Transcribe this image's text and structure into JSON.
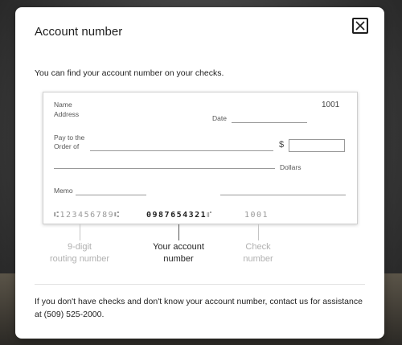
{
  "dialog": {
    "title": "Account number",
    "close_label": "close",
    "description": "You can find your account number on your checks.",
    "footer": "If you don't have checks and don't know your account number, contact us for assistance at (509) 525-2000."
  },
  "check": {
    "name": "Name",
    "address": "Address",
    "check_number": "1001",
    "date": "Date",
    "pay_to_line1": "Pay to the",
    "pay_to_line2": "Order of",
    "dollar_sign": "$",
    "dollars": "Dollars",
    "memo": "Memo",
    "micr_routing": "⑆123456789⑆",
    "micr_account": "0987654321",
    "micr_account_symbol": "⑈",
    "micr_check": "1001"
  },
  "captions": {
    "routing": [
      "9-digit",
      "routing number"
    ],
    "account": [
      "Your account",
      "number"
    ],
    "check": [
      "Check",
      "number"
    ]
  },
  "colors": {
    "highlight": "#1f1f1f",
    "muted": "#b0b0b0"
  }
}
